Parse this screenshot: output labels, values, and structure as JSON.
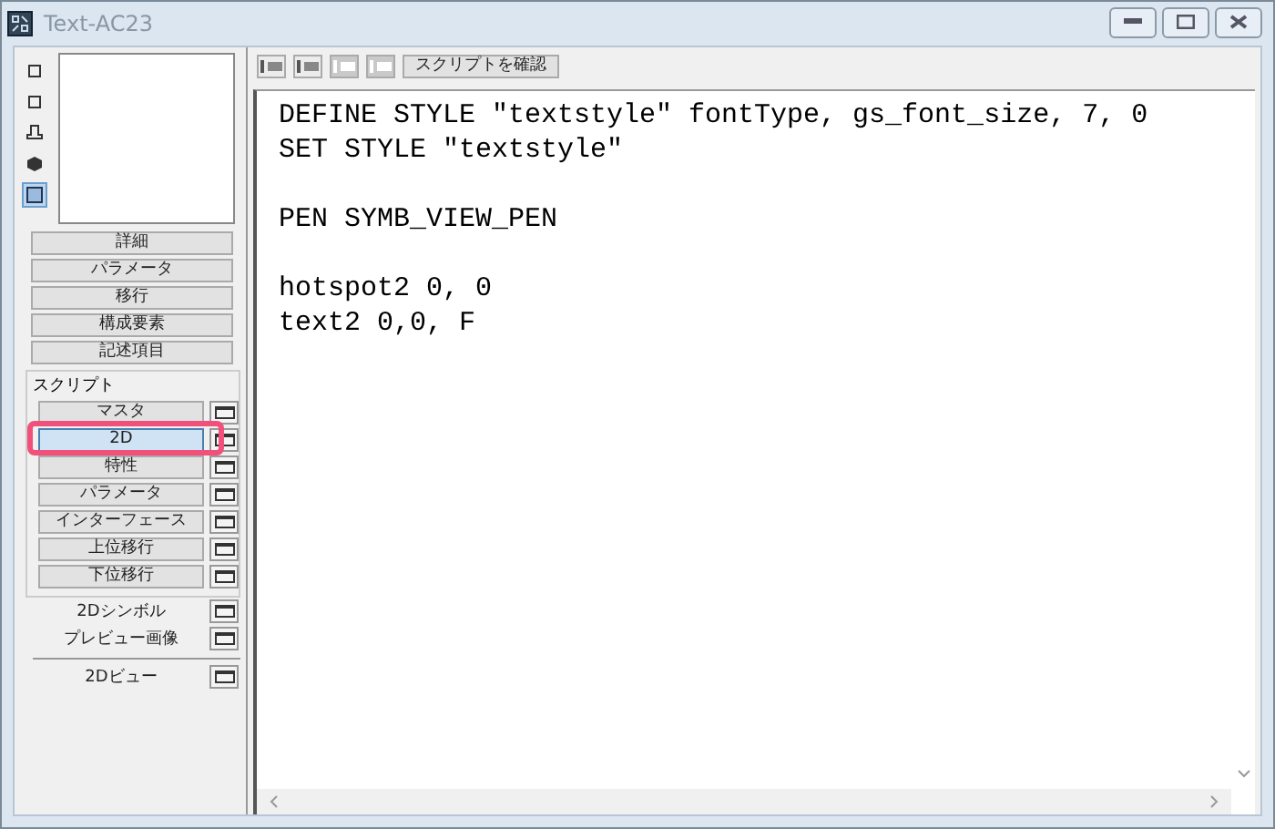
{
  "window": {
    "title": "Text-AC23"
  },
  "view_icons": [
    {
      "selected": false
    },
    {
      "selected": false
    },
    {
      "selected": false
    },
    {
      "selected": false
    },
    {
      "selected": true
    }
  ],
  "sections": [
    "詳細",
    "パラメータ",
    "移行",
    "構成要素",
    "記述項目"
  ],
  "scripts": {
    "label": "スクリプト",
    "items": [
      {
        "label": "マスタ",
        "selected": false
      },
      {
        "label": "2D",
        "selected": true
      },
      {
        "label": "特性",
        "selected": false
      },
      {
        "label": "パラメータ",
        "selected": false
      },
      {
        "label": "インターフェース",
        "selected": false
      },
      {
        "label": "上位移行",
        "selected": false
      },
      {
        "label": "下位移行",
        "selected": false
      }
    ]
  },
  "extras": [
    "2Dシンボル",
    "プレビュー画像"
  ],
  "view2d": "2Dビュー",
  "toolbar": {
    "check_button": "スクリプトを確認"
  },
  "code_blocks": [
    [
      "DEFINE STYLE \"textstyle\" fontType, gs_font_size, 7, 0",
      "SET STYLE \"textstyle\""
    ],
    [
      "PEN SYMB_VIEW_PEN"
    ],
    [
      "hotspot2 0, 0",
      "text2 0,0, F"
    ]
  ]
}
